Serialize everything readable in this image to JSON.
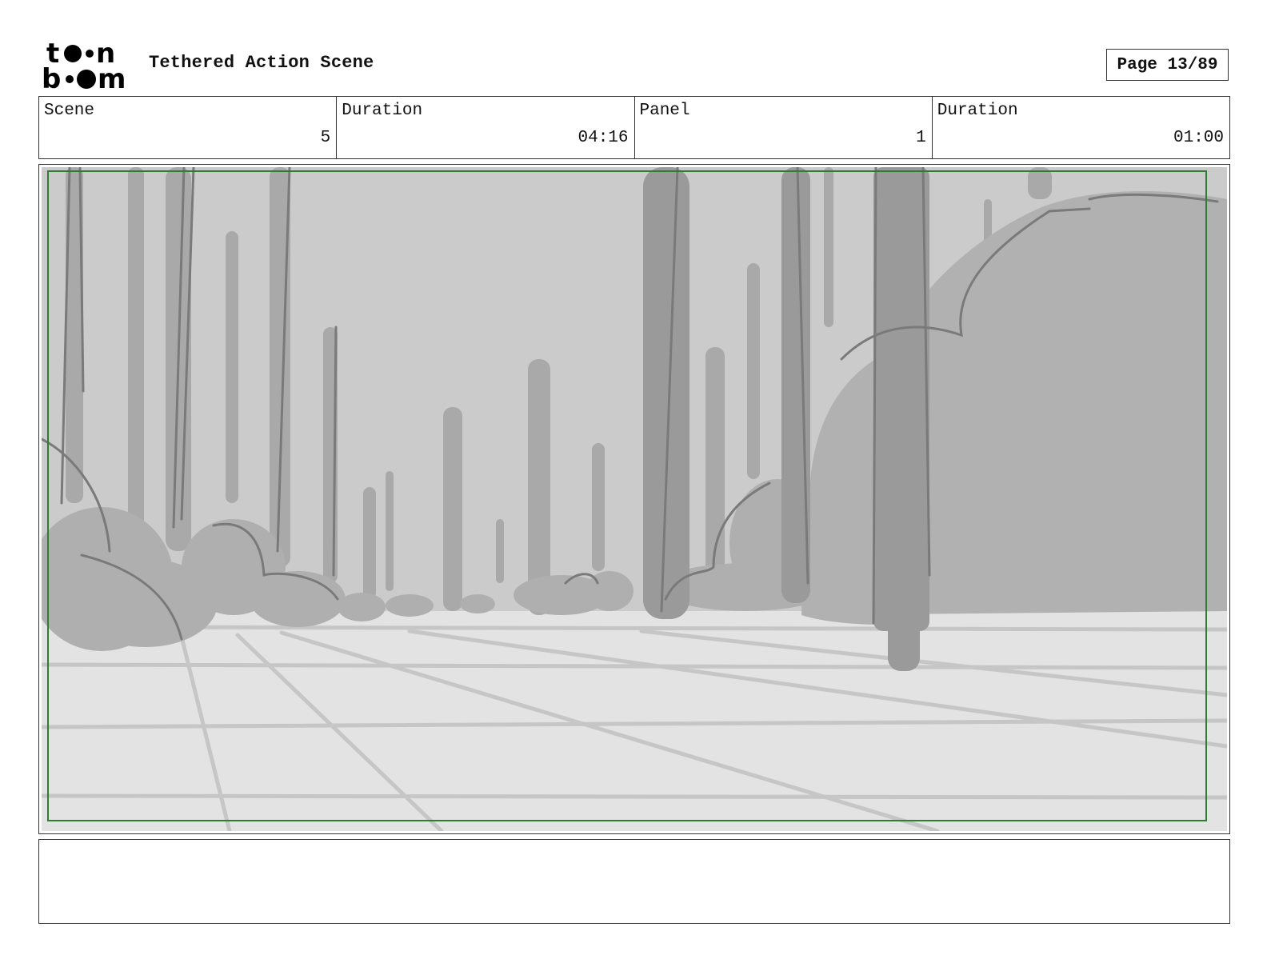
{
  "header": {
    "logo_text": "toonboom",
    "title": "Tethered Action Scene",
    "page_label": "Page 13/89"
  },
  "info": [
    {
      "label": "Scene",
      "value": "5"
    },
    {
      "label": "Duration",
      "value": "04:16"
    },
    {
      "label": "Panel",
      "value": "1"
    },
    {
      "label": "Duration",
      "value": "01:00"
    }
  ],
  "panel": {
    "image_description": "Grayscale storyboard sketch of a forest with tree trunks, bushes and a tiled ground plane",
    "safe_frame_color": "#2e7d32"
  },
  "notes": {
    "text": ""
  }
}
